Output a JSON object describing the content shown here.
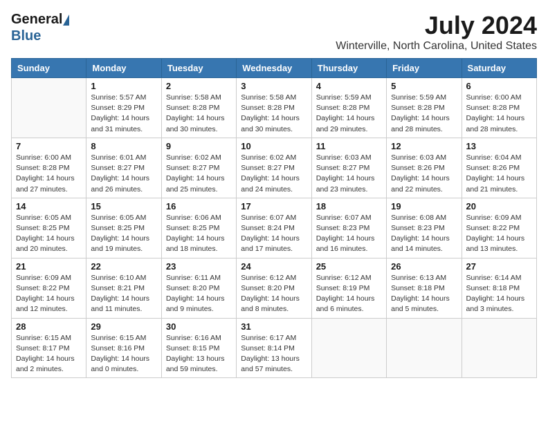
{
  "header": {
    "logo_general": "General",
    "logo_blue": "Blue",
    "month": "July 2024",
    "location": "Winterville, North Carolina, United States"
  },
  "days_of_week": [
    "Sunday",
    "Monday",
    "Tuesday",
    "Wednesday",
    "Thursday",
    "Friday",
    "Saturday"
  ],
  "weeks": [
    [
      {
        "day": "",
        "info": ""
      },
      {
        "day": "1",
        "info": "Sunrise: 5:57 AM\nSunset: 8:29 PM\nDaylight: 14 hours\nand 31 minutes."
      },
      {
        "day": "2",
        "info": "Sunrise: 5:58 AM\nSunset: 8:28 PM\nDaylight: 14 hours\nand 30 minutes."
      },
      {
        "day": "3",
        "info": "Sunrise: 5:58 AM\nSunset: 8:28 PM\nDaylight: 14 hours\nand 30 minutes."
      },
      {
        "day": "4",
        "info": "Sunrise: 5:59 AM\nSunset: 8:28 PM\nDaylight: 14 hours\nand 29 minutes."
      },
      {
        "day": "5",
        "info": "Sunrise: 5:59 AM\nSunset: 8:28 PM\nDaylight: 14 hours\nand 28 minutes."
      },
      {
        "day": "6",
        "info": "Sunrise: 6:00 AM\nSunset: 8:28 PM\nDaylight: 14 hours\nand 28 minutes."
      }
    ],
    [
      {
        "day": "7",
        "info": "Sunrise: 6:00 AM\nSunset: 8:28 PM\nDaylight: 14 hours\nand 27 minutes."
      },
      {
        "day": "8",
        "info": "Sunrise: 6:01 AM\nSunset: 8:27 PM\nDaylight: 14 hours\nand 26 minutes."
      },
      {
        "day": "9",
        "info": "Sunrise: 6:02 AM\nSunset: 8:27 PM\nDaylight: 14 hours\nand 25 minutes."
      },
      {
        "day": "10",
        "info": "Sunrise: 6:02 AM\nSunset: 8:27 PM\nDaylight: 14 hours\nand 24 minutes."
      },
      {
        "day": "11",
        "info": "Sunrise: 6:03 AM\nSunset: 8:27 PM\nDaylight: 14 hours\nand 23 minutes."
      },
      {
        "day": "12",
        "info": "Sunrise: 6:03 AM\nSunset: 8:26 PM\nDaylight: 14 hours\nand 22 minutes."
      },
      {
        "day": "13",
        "info": "Sunrise: 6:04 AM\nSunset: 8:26 PM\nDaylight: 14 hours\nand 21 minutes."
      }
    ],
    [
      {
        "day": "14",
        "info": "Sunrise: 6:05 AM\nSunset: 8:25 PM\nDaylight: 14 hours\nand 20 minutes."
      },
      {
        "day": "15",
        "info": "Sunrise: 6:05 AM\nSunset: 8:25 PM\nDaylight: 14 hours\nand 19 minutes."
      },
      {
        "day": "16",
        "info": "Sunrise: 6:06 AM\nSunset: 8:25 PM\nDaylight: 14 hours\nand 18 minutes."
      },
      {
        "day": "17",
        "info": "Sunrise: 6:07 AM\nSunset: 8:24 PM\nDaylight: 14 hours\nand 17 minutes."
      },
      {
        "day": "18",
        "info": "Sunrise: 6:07 AM\nSunset: 8:23 PM\nDaylight: 14 hours\nand 16 minutes."
      },
      {
        "day": "19",
        "info": "Sunrise: 6:08 AM\nSunset: 8:23 PM\nDaylight: 14 hours\nand 14 minutes."
      },
      {
        "day": "20",
        "info": "Sunrise: 6:09 AM\nSunset: 8:22 PM\nDaylight: 14 hours\nand 13 minutes."
      }
    ],
    [
      {
        "day": "21",
        "info": "Sunrise: 6:09 AM\nSunset: 8:22 PM\nDaylight: 14 hours\nand 12 minutes."
      },
      {
        "day": "22",
        "info": "Sunrise: 6:10 AM\nSunset: 8:21 PM\nDaylight: 14 hours\nand 11 minutes."
      },
      {
        "day": "23",
        "info": "Sunrise: 6:11 AM\nSunset: 8:20 PM\nDaylight: 14 hours\nand 9 minutes."
      },
      {
        "day": "24",
        "info": "Sunrise: 6:12 AM\nSunset: 8:20 PM\nDaylight: 14 hours\nand 8 minutes."
      },
      {
        "day": "25",
        "info": "Sunrise: 6:12 AM\nSunset: 8:19 PM\nDaylight: 14 hours\nand 6 minutes."
      },
      {
        "day": "26",
        "info": "Sunrise: 6:13 AM\nSunset: 8:18 PM\nDaylight: 14 hours\nand 5 minutes."
      },
      {
        "day": "27",
        "info": "Sunrise: 6:14 AM\nSunset: 8:18 PM\nDaylight: 14 hours\nand 3 minutes."
      }
    ],
    [
      {
        "day": "28",
        "info": "Sunrise: 6:15 AM\nSunset: 8:17 PM\nDaylight: 14 hours\nand 2 minutes."
      },
      {
        "day": "29",
        "info": "Sunrise: 6:15 AM\nSunset: 8:16 PM\nDaylight: 14 hours\nand 0 minutes."
      },
      {
        "day": "30",
        "info": "Sunrise: 6:16 AM\nSunset: 8:15 PM\nDaylight: 13 hours\nand 59 minutes."
      },
      {
        "day": "31",
        "info": "Sunrise: 6:17 AM\nSunset: 8:14 PM\nDaylight: 13 hours\nand 57 minutes."
      },
      {
        "day": "",
        "info": ""
      },
      {
        "day": "",
        "info": ""
      },
      {
        "day": "",
        "info": ""
      }
    ]
  ]
}
